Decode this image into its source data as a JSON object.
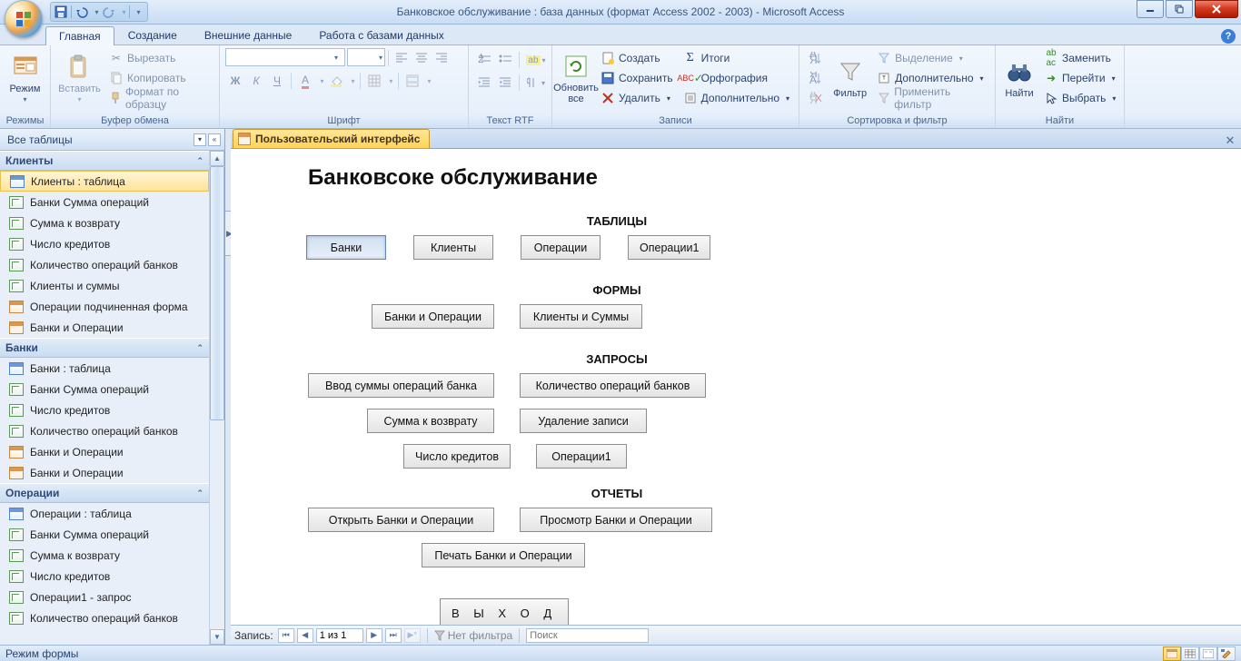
{
  "window": {
    "title": "Банковское обслуживание : база данных (формат Access 2002 - 2003) - Microsoft Access"
  },
  "tabs": {
    "home": "Главная",
    "create": "Создание",
    "external": "Внешние данные",
    "dbtools": "Работа с базами данных"
  },
  "ribbon": {
    "views": {
      "label": "Режимы",
      "view": "Режим"
    },
    "clipboard": {
      "label": "Буфер обмена",
      "paste": "Вставить",
      "cut": "Вырезать",
      "copy": "Копировать",
      "format_painter": "Формат по образцу"
    },
    "font": {
      "label": "Шрифт"
    },
    "richtext": {
      "label": "Текст RTF"
    },
    "records": {
      "label": "Записи",
      "refresh": "Обновить\nвсе",
      "new": "Создать",
      "save": "Сохранить",
      "delete": "Удалить",
      "totals": "Итоги",
      "spelling": "Орфография",
      "more": "Дополнительно"
    },
    "sortfilter": {
      "label": "Сортировка и фильтр",
      "filter": "Фильтр",
      "selection": "Выделение",
      "advanced": "Дополнительно",
      "toggle": "Применить фильтр"
    },
    "find": {
      "label": "Найти",
      "find_btn": "Найти",
      "replace": "Заменить",
      "goto": "Перейти",
      "select": "Выбрать"
    }
  },
  "navpane": {
    "header": "Все таблицы",
    "groups": [
      {
        "name": "Клиенты",
        "items": [
          {
            "type": "table",
            "label": "Клиенты : таблица",
            "selected": true
          },
          {
            "type": "query",
            "label": "Банки Сумма операций"
          },
          {
            "type": "query",
            "label": "Сумма к возврату"
          },
          {
            "type": "query",
            "label": "Число кредитов"
          },
          {
            "type": "query",
            "label": "Количество операций банков"
          },
          {
            "type": "query",
            "label": "Клиенты и суммы"
          },
          {
            "type": "form",
            "label": "Операции подчиненная форма"
          },
          {
            "type": "form",
            "label": "Банки и Операции"
          }
        ]
      },
      {
        "name": "Банки",
        "items": [
          {
            "type": "table",
            "label": "Банки : таблица"
          },
          {
            "type": "query",
            "label": "Банки Сумма операций"
          },
          {
            "type": "query",
            "label": "Число кредитов"
          },
          {
            "type": "query",
            "label": "Количество операций банков"
          },
          {
            "type": "form",
            "label": "Банки и Операции"
          },
          {
            "type": "form",
            "label": "Банки и Операции"
          }
        ]
      },
      {
        "name": "Операции",
        "items": [
          {
            "type": "table",
            "label": "Операции : таблица"
          },
          {
            "type": "query",
            "label": "Банки Сумма операций"
          },
          {
            "type": "query",
            "label": "Сумма к возврату"
          },
          {
            "type": "query",
            "label": "Число кредитов"
          },
          {
            "type": "query",
            "label": "Операции1 - запрос"
          },
          {
            "type": "query",
            "label": "Количество операций банков"
          }
        ]
      }
    ]
  },
  "doc_tab": "Пользовательский интерфейс",
  "form": {
    "title": "Банковсоке обслуживание",
    "sections": {
      "tables": {
        "header": "ТАБЛИЦЫ",
        "buttons": [
          "Банки",
          "Клиенты",
          "Операции",
          "Операции1"
        ]
      },
      "forms": {
        "header": "ФОРМЫ",
        "buttons": [
          "Банки и Операции",
          "Клиенты и Суммы"
        ]
      },
      "queries": {
        "header": "ЗАПРОСЫ",
        "buttons": [
          "Ввод суммы операций банка",
          "Количество операций банков",
          "Сумма к возврату",
          "Удаление записи",
          "Число кредитов",
          "Операции1"
        ]
      },
      "reports": {
        "header": "ОТЧЕТЫ",
        "buttons": [
          "Открыть Банки и Операции",
          "Просмотр Банки и Операции",
          "Печать Банки и Операции"
        ]
      }
    },
    "exit": "В Ы Х О Д"
  },
  "record_nav": {
    "label": "Запись:",
    "pos": "1 из 1",
    "nofilter": "Нет фильтра",
    "search": "Поиск"
  },
  "statusbar": "Режим формы"
}
